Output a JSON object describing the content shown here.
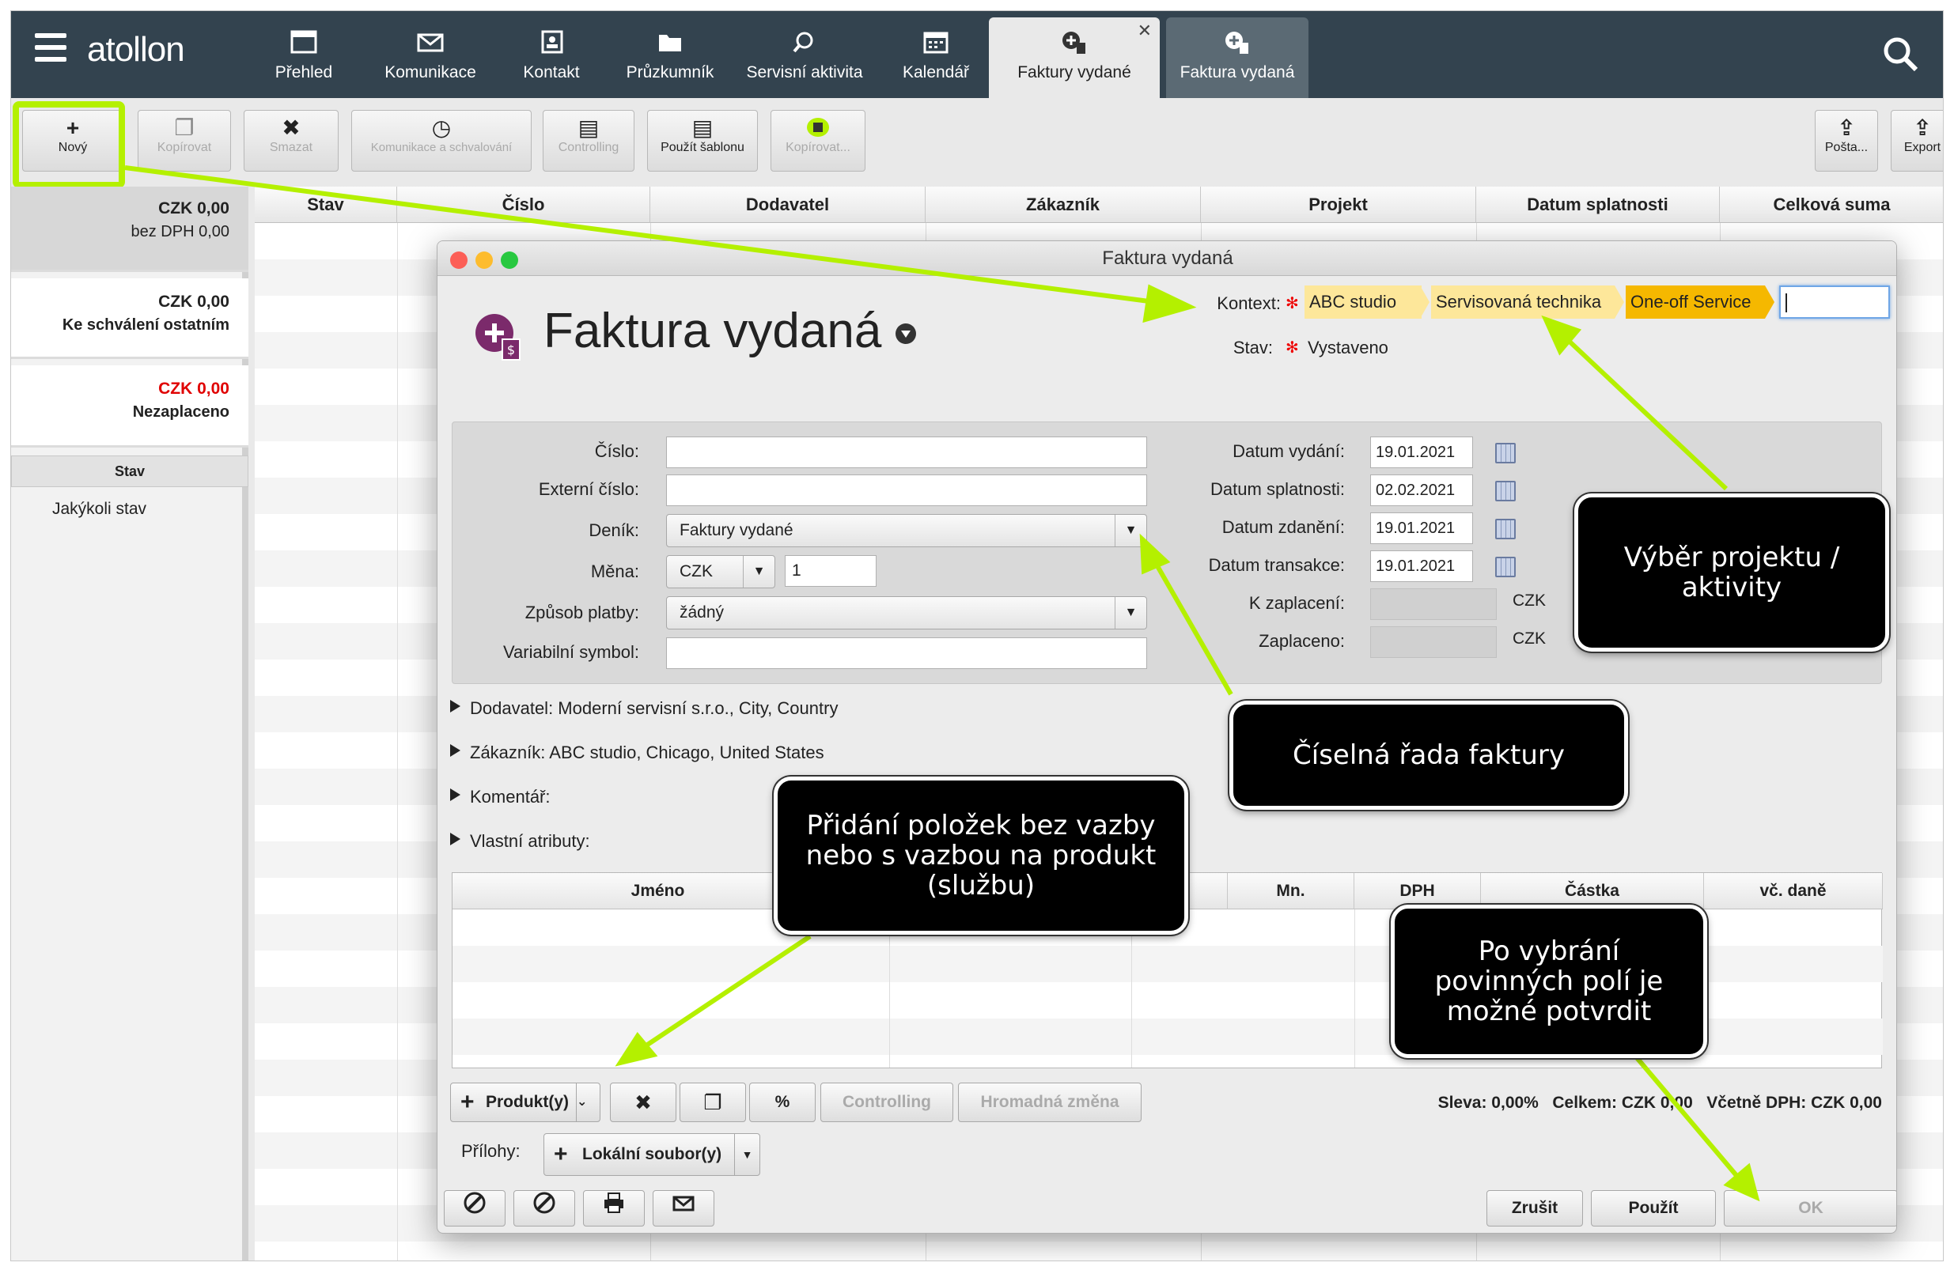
{
  "app": {
    "brand": "atollon",
    "nav": [
      {
        "label": "Přehled",
        "icon": "window-icon"
      },
      {
        "label": "Komunikace",
        "icon": "mail-icon"
      },
      {
        "label": "Kontakt",
        "icon": "contact-icon"
      },
      {
        "label": "Průzkumník",
        "icon": "folder-icon"
      },
      {
        "label": "Servisní aktivita",
        "icon": "service-icon"
      },
      {
        "label": "Kalendář",
        "icon": "calendar-icon"
      }
    ],
    "tabs": [
      {
        "label": "Faktury vydané",
        "icon": "invoice-icon",
        "active": true
      },
      {
        "label": "Faktura vydaná",
        "icon": "invoice-icon",
        "active": false
      }
    ]
  },
  "toolbar": {
    "new": "Nový",
    "copy": "Kopírovat",
    "delete": "Smazat",
    "communication": "Komunikace a schvalování",
    "controlling": "Controlling",
    "use_template": "Použít šablonu",
    "copy2": "Kopírovat...",
    "mail": "Pošta...",
    "export": "Export"
  },
  "sidebar": {
    "cards": [
      {
        "amount": "CZK 0,00",
        "subtitle": "bez DPH 0,00",
        "selected": true
      },
      {
        "amount": "CZK 0,00",
        "subtitle": "Ke schválení ostatním",
        "selected": false
      },
      {
        "amount": "CZK 0,00",
        "subtitle": "Nezaplaceno",
        "selected": false,
        "amount_color": "#e00000"
      }
    ],
    "filter_header": "Stav",
    "filter_value": "Jakýkoli stav"
  },
  "grid": {
    "columns": [
      "Stav",
      "Číslo",
      "Dodavatel",
      "Zákazník",
      "Projekt",
      "Datum splatnosti",
      "Celková suma"
    ]
  },
  "dialog": {
    "window_title": "Faktura vydaná",
    "title": "Faktura vydaná",
    "context_label": "Kontext:",
    "context_path": [
      "ABC studio",
      "Servisovaná technika",
      "One-off Service"
    ],
    "state_label": "Stav:",
    "state_value": "Vystaveno",
    "fields": {
      "cislo_label": "Číslo:",
      "cislo_value": "",
      "externi_label": "Externí číslo:",
      "externi_value": "",
      "denik_label": "Deník:",
      "denik_value": "Faktury vydané",
      "mena_label": "Měna:",
      "mena_value": "CZK",
      "kurz_value": "1",
      "platba_label": "Způsob platby:",
      "platba_value": "žádný",
      "vs_label": "Variabilní symbol:",
      "vs_value": ""
    },
    "dates": {
      "vydani_label": "Datum vydání:",
      "vydani_value": "19.01.2021",
      "splatnosti_label": "Datum splatnosti:",
      "splatnosti_value": "02.02.2021",
      "zdaneni_label": "Datum zdanění:",
      "zdaneni_value": "19.01.2021",
      "transakce_label": "Datum transakce:",
      "transakce_value": "19.01.2021",
      "k_zaplaceni_label": "K zaplacení:",
      "zaplaceno_label": "Zaplaceno:",
      "currency": "CZK"
    },
    "sections": {
      "dodavatel": "Dodavatel:  Moderní servisní s.r.o., City, Country",
      "zakaznik": "Zákazník:  ABC studio, Chicago, United States",
      "komentar": "Komentář:",
      "atributy": "Vlastní atributy:"
    },
    "items_columns": [
      "Jméno",
      "Mn.",
      "DPH",
      "Částka",
      "vč. daně"
    ],
    "item_buttons": {
      "products": "Produkt(y)",
      "percent": "%",
      "controlling": "Controlling",
      "bulk": "Hromadná změna"
    },
    "totals": "Sleva: 0,00%   Celkem: CZK 0,00   Včetně DPH: CZK 0,00",
    "attachments_label": "Přílohy:",
    "attachments_button": "Lokální soubor(y)",
    "footer": {
      "cancel": "Zrušit",
      "apply": "Použít",
      "ok": "OK"
    }
  },
  "callouts": {
    "project": "Výběr projektu / aktivity",
    "series": "Číselná řada faktury",
    "items": "Přidání položek bez vazby nebo s vazbou na produkt (službu)",
    "confirm": "Po vybrání povinných polí je možné potvrdit"
  },
  "colors": {
    "topbar": "#33434f",
    "highlight": "#b4f000",
    "breadcrumb_active": "#f5b800",
    "breadcrumb": "#fde79a"
  }
}
